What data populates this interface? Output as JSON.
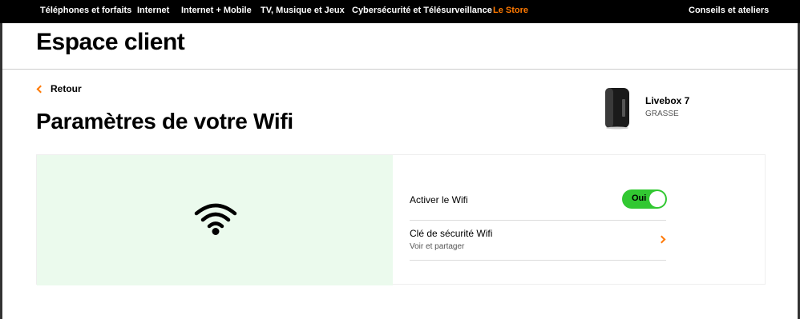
{
  "topnav": {
    "items": [
      "Téléphones et forfaits",
      "Internet",
      "Internet + Mobile",
      "TV, Musique et Jeux",
      "Cybersécurité et Télésurveillance",
      "Le Store"
    ],
    "right_item": "Conseils et ateliers"
  },
  "header": {
    "title": "Espace client"
  },
  "back": {
    "label": "Retour"
  },
  "page": {
    "title": "Paramètres de votre Wifi"
  },
  "device": {
    "name": "Livebox 7",
    "location": "GRASSE",
    "icon": "livebox-device"
  },
  "wifi": {
    "visual_icon": "wifi-icon",
    "activate_label": "Activer le Wifi",
    "toggle_label": "Oui",
    "toggle_state": true,
    "key_label": "Clé de sécurité Wifi",
    "key_sub": "Voir et partager"
  },
  "colors": {
    "brand_orange": "#ff7900",
    "toggle_green": "#32c832",
    "visual_bg": "#ebfaed",
    "nav_bg": "#000000"
  }
}
